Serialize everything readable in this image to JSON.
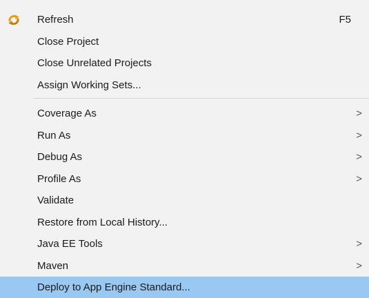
{
  "menu": {
    "group1": [
      {
        "label": "Refresh",
        "shortcut": "F5",
        "icon": "refresh-icon"
      },
      {
        "label": "Close Project"
      },
      {
        "label": "Close Unrelated Projects"
      },
      {
        "label": "Assign Working Sets..."
      }
    ],
    "group2": [
      {
        "label": "Coverage As",
        "submenu": ">"
      },
      {
        "label": "Run As",
        "submenu": ">"
      },
      {
        "label": "Debug As",
        "submenu": ">"
      },
      {
        "label": "Profile As",
        "submenu": ">"
      },
      {
        "label": "Validate"
      },
      {
        "label": "Restore from Local History..."
      },
      {
        "label": "Java EE Tools",
        "submenu": ">"
      },
      {
        "label": "Maven",
        "submenu": ">"
      },
      {
        "label": "Deploy to App Engine Standard...",
        "highlighted": true
      }
    ]
  },
  "colors": {
    "menu_background": "#f2f2f2",
    "highlight": "#99c9f2",
    "separator": "#d6d6d6"
  }
}
